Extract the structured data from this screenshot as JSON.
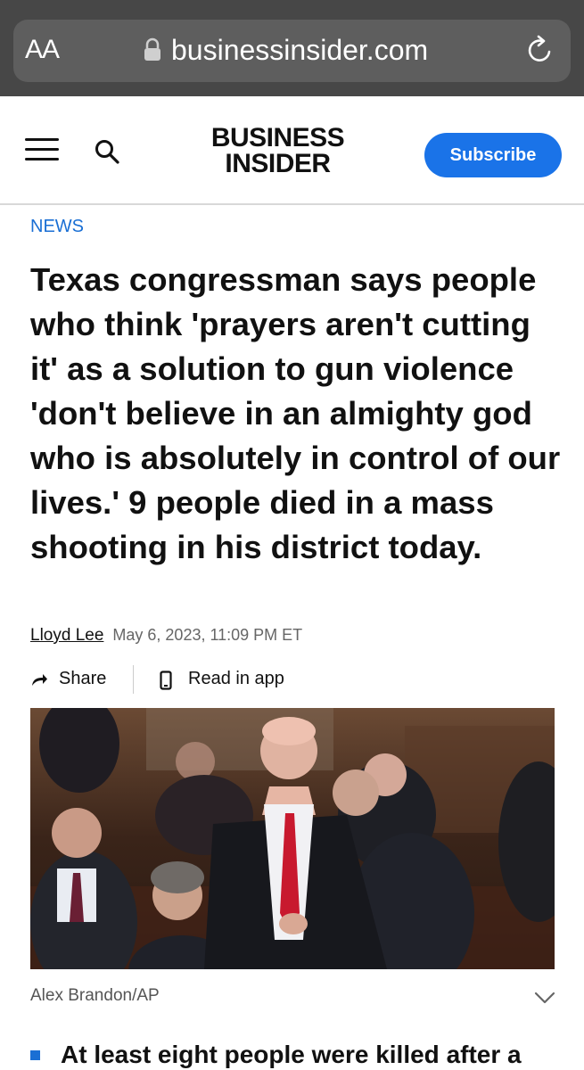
{
  "browser": {
    "text_size_label": "AA",
    "url": "businessinsider.com"
  },
  "header": {
    "logo_line1": "BUSINESS",
    "logo_line2": "INSIDER",
    "subscribe_label": "Subscribe"
  },
  "article": {
    "section": "NEWS",
    "headline": "Texas congressman says people who think 'prayers aren't cutting it' as a solution to gun violence 'don't believe in an almighty god who is absolutely in control of our lives.' 9 people died in a mass shooting in his district today.",
    "author": "Lloyd Lee",
    "date": "May 6, 2023, 11:09 PM ET",
    "share_label": "Share",
    "read_in_app_label": "Read in app",
    "photo_credit": "Alex Brandon/AP",
    "bullet_1": "At least eight people were killed after a"
  },
  "colors": {
    "accent": "#1a73e8",
    "section": "#1a6fd4",
    "browser_bar": "#474747"
  }
}
